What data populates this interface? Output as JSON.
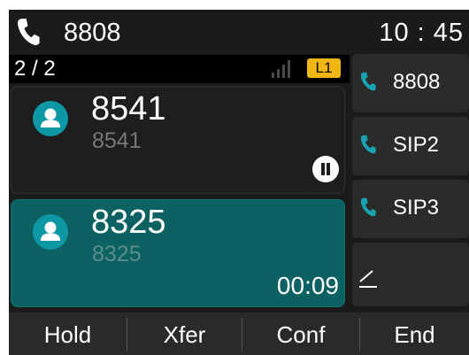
{
  "status_bar": {
    "account": "8808",
    "time": "10 : 45",
    "icon": "phone-handset-icon"
  },
  "call_list": {
    "count": "2 / 2",
    "line_badge": "L1"
  },
  "calls": [
    {
      "name": "8541",
      "number": "8541",
      "state_icon": "hold-icon"
    },
    {
      "name": "8325",
      "number": "8325",
      "duration": "00:09"
    }
  ],
  "line_keys": [
    {
      "label": "8808",
      "icon": "phone-handset-icon"
    },
    {
      "label": "SIP2",
      "icon": "phone-handset-icon"
    },
    {
      "label": "SIP3",
      "icon": "phone-handset-icon"
    },
    {
      "label": "",
      "icon": "edit-pencil-icon"
    }
  ],
  "softkeys": [
    "Hold",
    "Xfer",
    "Conf",
    "End"
  ],
  "colors": {
    "background": "#1b1b1b",
    "active_call": "#0c6262",
    "phone_icon": "#17a3b3",
    "line_badge": "#f0b614",
    "avatar": "#0e98a6"
  }
}
